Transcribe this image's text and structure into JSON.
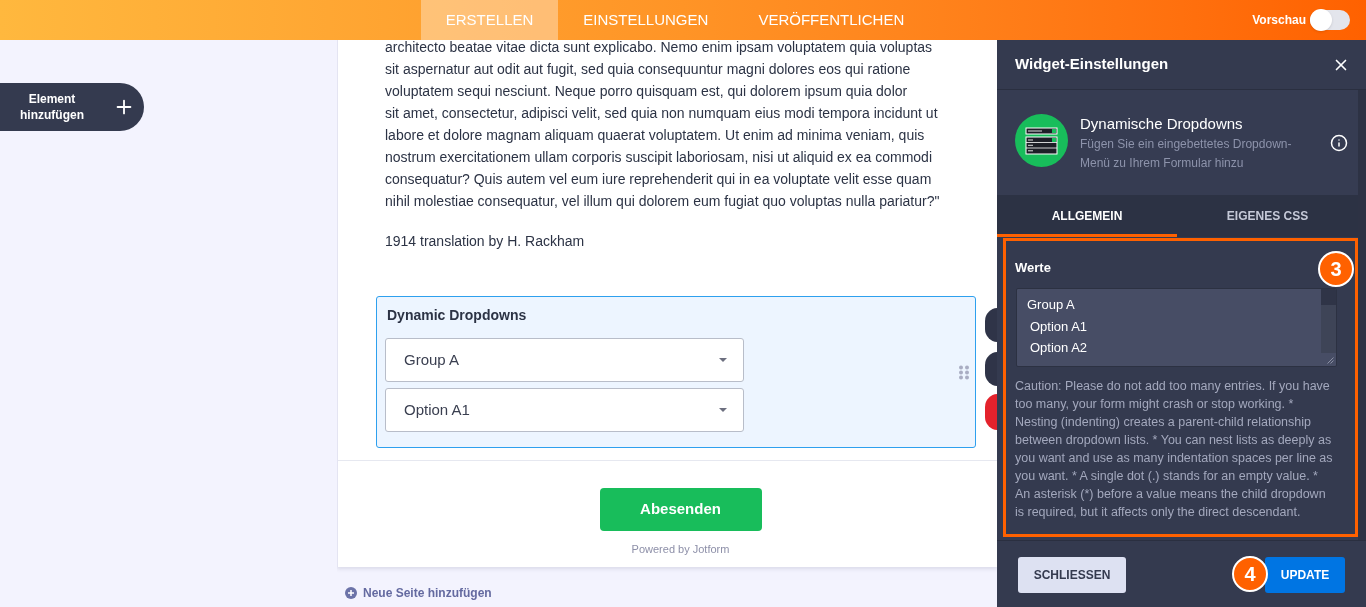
{
  "header": {
    "tabs": [
      {
        "label": "ERSTELLEN",
        "selected": true
      },
      {
        "label": "EINSTELLUNGEN",
        "selected": false
      },
      {
        "label": "VERÖFFENTLICHEN",
        "selected": false
      }
    ],
    "preview": {
      "label": "Vorschau",
      "on": false
    }
  },
  "sidebar": {
    "add_element_button": "Element hinzufügen"
  },
  "form": {
    "paragraph": "architecto beatae vitae dicta sunt explicabo. Nemo enim ipsam voluptatem quia voluptas\nsit aspernatur aut odit aut fugit, sed quia consequuntur magni dolores eos qui ratione\nvoluptatem sequi nesciunt. Neque porro quisquam est, qui dolorem ipsum quia dolor\nsit amet, consectetur, adipisci velit, sed quia non numquam eius modi tempora incidunt ut\nlabore et dolore magnam aliquam quaerat voluptatem. Ut enim ad minima veniam, quis\nnostrum exercitationem ullam corporis suscipit laboriosam, nisi ut aliquid ex ea commodi\nconsequatur? Quis autem vel eum iure reprehenderit qui in ea voluptate velit esse quam\nnihil molestiae consequatur, vel illum qui dolorem eum fugiat quo voluptas nulla pariatur?\"",
    "credit": "1914 translation by H. Rackham",
    "field": {
      "label": "Dynamic Dropdowns",
      "selects": [
        {
          "value": "Group A"
        },
        {
          "value": "Option A1"
        }
      ]
    },
    "submit_button": "Abesenden",
    "footer_note": "Powered by Jotform"
  },
  "add_page_link": "Neue Seite hinzufügen",
  "panel": {
    "title": "Widget-Einstellungen",
    "widget": {
      "name": "Dynamische Dropdowns",
      "description": "Fügen Sie ein eingebettetes Dropdown-Menü zu Ihrem Formular hinzu"
    },
    "tabs": [
      {
        "label": "ALLGEMEIN",
        "selected": true
      },
      {
        "label": "EIGENES CSS",
        "selected": false
      }
    ],
    "values_label": "Werte",
    "values_badge": "3",
    "values": [
      {
        "text": "Group A",
        "children": [
          {
            "text": "Option A1"
          },
          {
            "text": "Option A2"
          }
        ]
      }
    ],
    "caution": "Caution: Please do not add too many entries. If you have too many, your form might crash or stop working. * Nesting (indenting) creates a parent-child relationship between dropdown lists. * You can nest lists as deeply as you want and use as many indentation spaces per line as you want. * A single dot (.) stands for an empty value. * An asterisk (*) before a value means the child dropdown is required, but it affects only the direct descendant.",
    "buttons": [
      {
        "label": "SCHLIESSEN",
        "kind": "secondary"
      },
      {
        "label": "UPDATE",
        "kind": "primary",
        "badge": "4"
      }
    ]
  }
}
